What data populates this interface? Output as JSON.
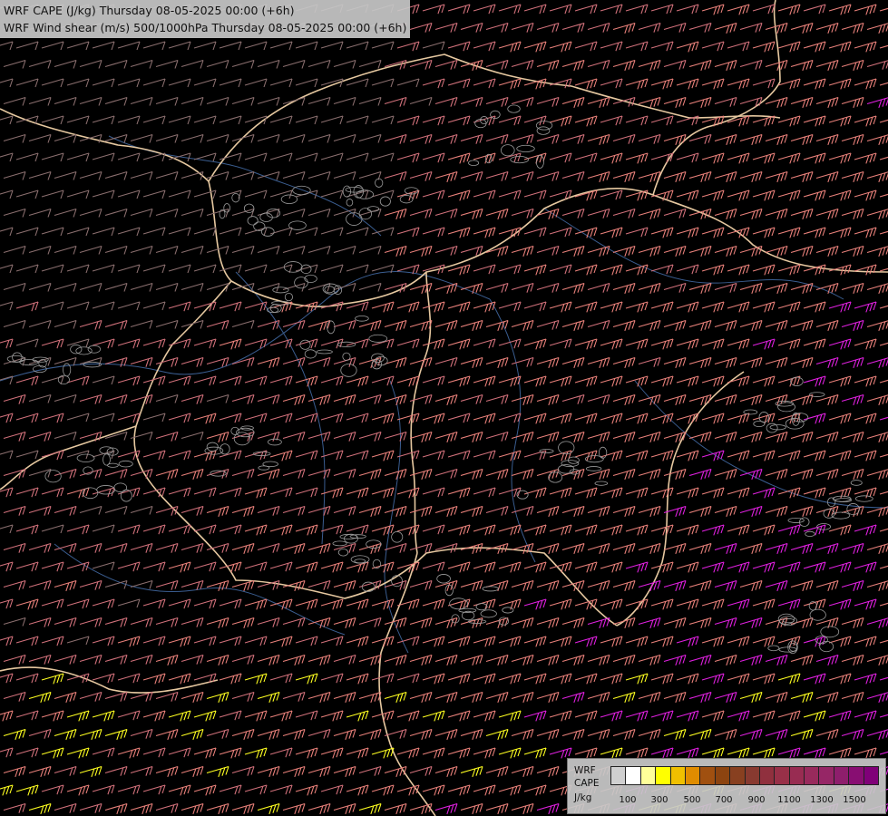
{
  "titles": {
    "line1": "WRF CAPE (J/kg) Thursday 08-05-2025 00:00 (+6h)",
    "line2": "WRF Wind shear (m/s) 500/1000hPa Thursday 08-05-2025 00:00 (+6h)"
  },
  "legend": {
    "label_top": "WRF",
    "label_mid": "CAPE",
    "label_unit": "J/kg",
    "ticks": [
      "100",
      "300",
      "500",
      "700",
      "900",
      "1100",
      "1300",
      "1500"
    ],
    "colors": [
      "#d0d0d0",
      "#ffffff",
      "#ffff99",
      "#ffff00",
      "#f0c000",
      "#e08c00",
      "#a05010",
      "#8c4410",
      "#884020",
      "#883a30",
      "#90303e",
      "#983048",
      "#982c52",
      "#982a5c",
      "#962666",
      "#8e1e6c",
      "#880e72",
      "#800078"
    ]
  },
  "map": {
    "background": "#000000",
    "barb_colors": {
      "weak": "#8a6e6e",
      "moderate": "#d0707a",
      "strong": "#e8807a",
      "intense": "#e020e0",
      "extreme": "#ffff20"
    },
    "border_color": "#e6c8a0",
    "river_color": "#3a5d90"
  }
}
